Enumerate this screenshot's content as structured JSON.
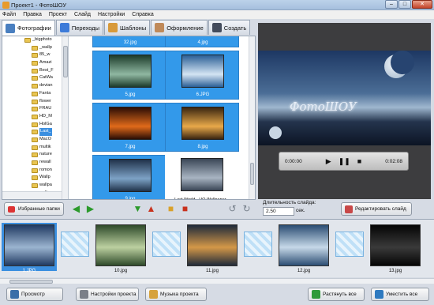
{
  "window": {
    "title": "Проект1 - ФотоШОУ",
    "minimize": "–",
    "maximize": "□",
    "close": "✕"
  },
  "menu": [
    "Файл",
    "Правка",
    "Проект",
    "Слайд",
    "Настройки",
    "Справка"
  ],
  "tabs": [
    {
      "label": "Фотографии",
      "color": "#4a7fc0"
    },
    {
      "label": "Переходы",
      "color": "#3d7bd9"
    },
    {
      "label": "Шаблоны",
      "color": "#d89a3a"
    },
    {
      "label": "Оформление",
      "color": "#c08a5a"
    },
    {
      "label": "Создать",
      "color": "#444c5c"
    }
  ],
  "tree": [
    "_bigphoto",
    "_wallp",
    "85_w",
    "Amazi",
    "Best_F",
    "CatWa",
    "devian",
    "Fanta",
    "flower",
    "FRAU",
    "HD_M",
    "HolGa",
    "Last_",
    "MacO",
    "multik",
    "nature",
    "rewall",
    "romon",
    "Wallp",
    "wallpa",
    "wallpa",
    "Wallp-"
  ],
  "grid": [
    {
      "caption": "32.jpg",
      "colors": "#3a6ea8,#c8d8ea",
      "selected": true
    },
    {
      "caption": "4.jpg",
      "colors": "#2f5c8a,#a9c2da",
      "selected": true
    },
    {
      "caption": "5.jpg",
      "colors": "#1c3b2a,#8fb7a1",
      "selected": true
    },
    {
      "caption": "6.JPG",
      "colors": "#2b5f96,#d4e4f3",
      "selected": true
    },
    {
      "caption": "7.jpg",
      "colors": "#2a0d05,#e06a1a",
      "selected": true
    },
    {
      "caption": "8.jpg",
      "colors": "#3a2510,#e8a94a",
      "selected": true
    },
    {
      "caption": "9.jpg",
      "colors": "#20324a,#7da2c6",
      "selected": true
    },
    {
      "caption": "Last World - HQ Wallpaper...",
      "colors": "#3a4656,#a8b4c2",
      "selected": false
    }
  ],
  "preview": {
    "logo": "ФотоШОУ",
    "time_start": "0:00:00",
    "time_end": "0:02:08"
  },
  "controls": {
    "favorites": "Избранные папки",
    "duration_label": "Длительность слайда:",
    "duration_value": "2.50",
    "duration_unit": "сек.",
    "edit_slide": "Редактировать слайд"
  },
  "slides": [
    {
      "caption": "1.JPG",
      "colors": "#203a62,#9bb4d0",
      "selected": true
    },
    {
      "caption": "10.jpg",
      "colors": "#2e4a2a,#bcd0a0",
      "selected": false
    },
    {
      "caption": "11.jpg",
      "colors": "#1f2a3a,#d49848",
      "selected": false
    },
    {
      "caption": "12.jpg",
      "colors": "#2b4d73,#c6d8e8",
      "selected": false
    },
    {
      "caption": "13.jpg",
      "colors": "#050505,#3a3a3a",
      "selected": false
    }
  ],
  "footer": {
    "preview": "Просмотр",
    "project_settings": "Настройки проекта",
    "music": "Музыка проекта",
    "stretch_all": "Растянуть все",
    "fit_all": "Уместить все"
  }
}
